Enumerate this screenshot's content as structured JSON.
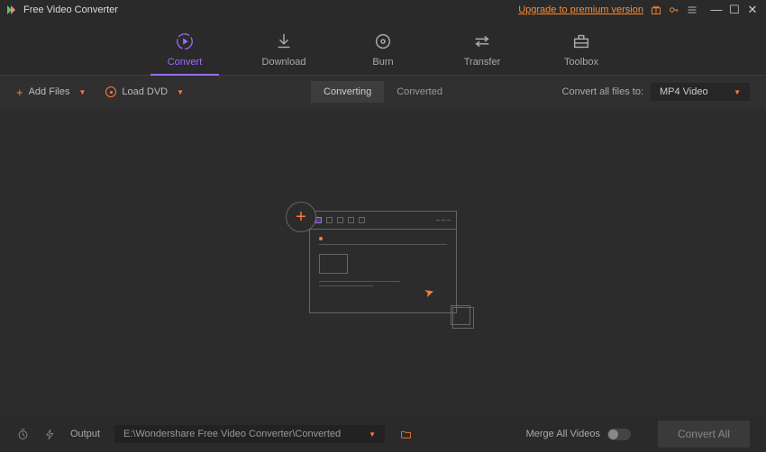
{
  "title": "Free Video Converter",
  "upgrade_text": "Upgrade to premium version",
  "tabs": [
    {
      "label": "Convert"
    },
    {
      "label": "Download"
    },
    {
      "label": "Burn"
    },
    {
      "label": "Transfer"
    },
    {
      "label": "Toolbox"
    }
  ],
  "toolbar": {
    "add_files": "Add Files",
    "load_dvd": "Load DVD",
    "converting": "Converting",
    "converted": "Converted",
    "convert_to_label": "Convert all files to:",
    "format_value": "MP4 Video"
  },
  "footer": {
    "output_label": "Output",
    "output_path": "E:\\Wondershare Free Video Converter\\Converted",
    "merge_label": "Merge All Videos",
    "convert_all": "Convert All"
  }
}
